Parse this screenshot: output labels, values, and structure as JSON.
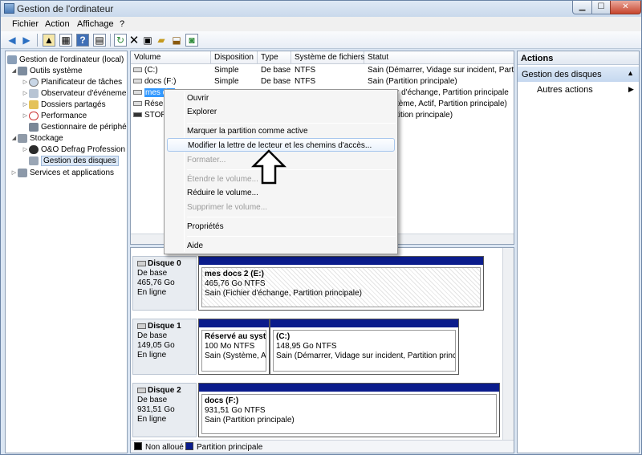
{
  "window": {
    "title": "Gestion de l'ordinateur"
  },
  "menu": {
    "fichier": "Fichier",
    "action": "Action",
    "affichage": "Affichage",
    "help": "?"
  },
  "tree": {
    "items": [
      {
        "label": "Gestion de l'ordinateur (local)"
      },
      {
        "label": "Outils système"
      },
      {
        "label": "Planificateur de tâches"
      },
      {
        "label": "Observateur d'événeme"
      },
      {
        "label": "Dossiers partagés"
      },
      {
        "label": "Performance"
      },
      {
        "label": "Gestionnaire de périphé"
      },
      {
        "label": "Stockage"
      },
      {
        "label": "O&O Defrag Profession"
      },
      {
        "label": "Gestion des disques"
      },
      {
        "label": "Services et applications"
      }
    ]
  },
  "volumes": {
    "headers": [
      "Volume",
      "Disposition",
      "Type",
      "Système de fichiers",
      "Statut"
    ],
    "rows": [
      {
        "volume": "(C:)",
        "disposition": "Simple",
        "type": "De base",
        "fs": "NTFS",
        "statut": "Sain (Démarrer, Vidage sur incident, Partitio"
      },
      {
        "volume": "docs (F:)",
        "disposition": "Simple",
        "type": "De base",
        "fs": "NTFS",
        "statut": "Sain (Partition principale)"
      },
      {
        "volume": "mes d",
        "disposition": "",
        "type": "",
        "fs": "",
        "statut": "r d'échange, Partition principale"
      },
      {
        "volume": "Réserv",
        "disposition": "",
        "type": "",
        "fs": "",
        "statut": "tème, Actif, Partition principale)"
      },
      {
        "volume": "STORE",
        "disposition": "",
        "type": "",
        "fs": "",
        "statut": "tition principale)"
      }
    ]
  },
  "disks": [
    {
      "name": "Disque 0",
      "type": "De base",
      "size": "465,76 Go",
      "state": "En ligne",
      "partitions": [
        {
          "name": "mes docs 2  (E:)",
          "size": "465,76 Go NTFS",
          "status": "Sain (Fichier d'échange, Partition principale)"
        }
      ]
    },
    {
      "name": "Disque 1",
      "type": "De base",
      "size": "149,05 Go",
      "state": "En ligne",
      "partitions": [
        {
          "name": "Réservé au systèr",
          "size": "100 Mo NTFS",
          "status": "Sain (Système, Act"
        },
        {
          "name": "(C:)",
          "size": "148,95 Go NTFS",
          "status": "Sain (Démarrer, Vidage sur incident, Partition principa"
        }
      ]
    },
    {
      "name": "Disque 2",
      "type": "De base",
      "size": "931,51 Go",
      "state": "En ligne",
      "partitions": [
        {
          "name": "docs  (F:)",
          "size": "931,51 Go NTFS",
          "status": "Sain (Partition principale)"
        }
      ]
    }
  ],
  "legend": {
    "unallocated": "Non alloué",
    "primary": "Partition principale",
    "unallocated_color": "#000000",
    "primary_color": "#0b1c8c"
  },
  "actions": {
    "header": "Actions",
    "section": "Gestion des disques",
    "more": "Autres actions"
  },
  "context_menu": {
    "items": [
      {
        "label": "Ouvrir",
        "enabled": true
      },
      {
        "label": "Explorer",
        "enabled": true
      },
      {
        "label": "Marquer la partition comme active",
        "enabled": true
      },
      {
        "label": "Modifier la lettre de lecteur et les chemins d'accès...",
        "enabled": true,
        "highlighted": true
      },
      {
        "label": "Formater...",
        "enabled": false
      },
      {
        "label": "Étendre le volume...",
        "enabled": false
      },
      {
        "label": "Réduire le volume...",
        "enabled": true
      },
      {
        "label": "Supprimer le volume...",
        "enabled": false
      },
      {
        "label": "Propriétés",
        "enabled": true
      },
      {
        "label": "Aide",
        "enabled": true
      }
    ]
  },
  "icons": [
    "app-icon",
    "back-arrow-icon",
    "forward-arrow-icon",
    "up-folder-icon",
    "console-tree-icon",
    "help-icon",
    "properties-icon",
    "refresh-icon",
    "delete-icon",
    "properties-sheet-icon",
    "open-folder-icon",
    "export-icon",
    "disk-icon",
    "arrow-up-annotation-icon"
  ]
}
